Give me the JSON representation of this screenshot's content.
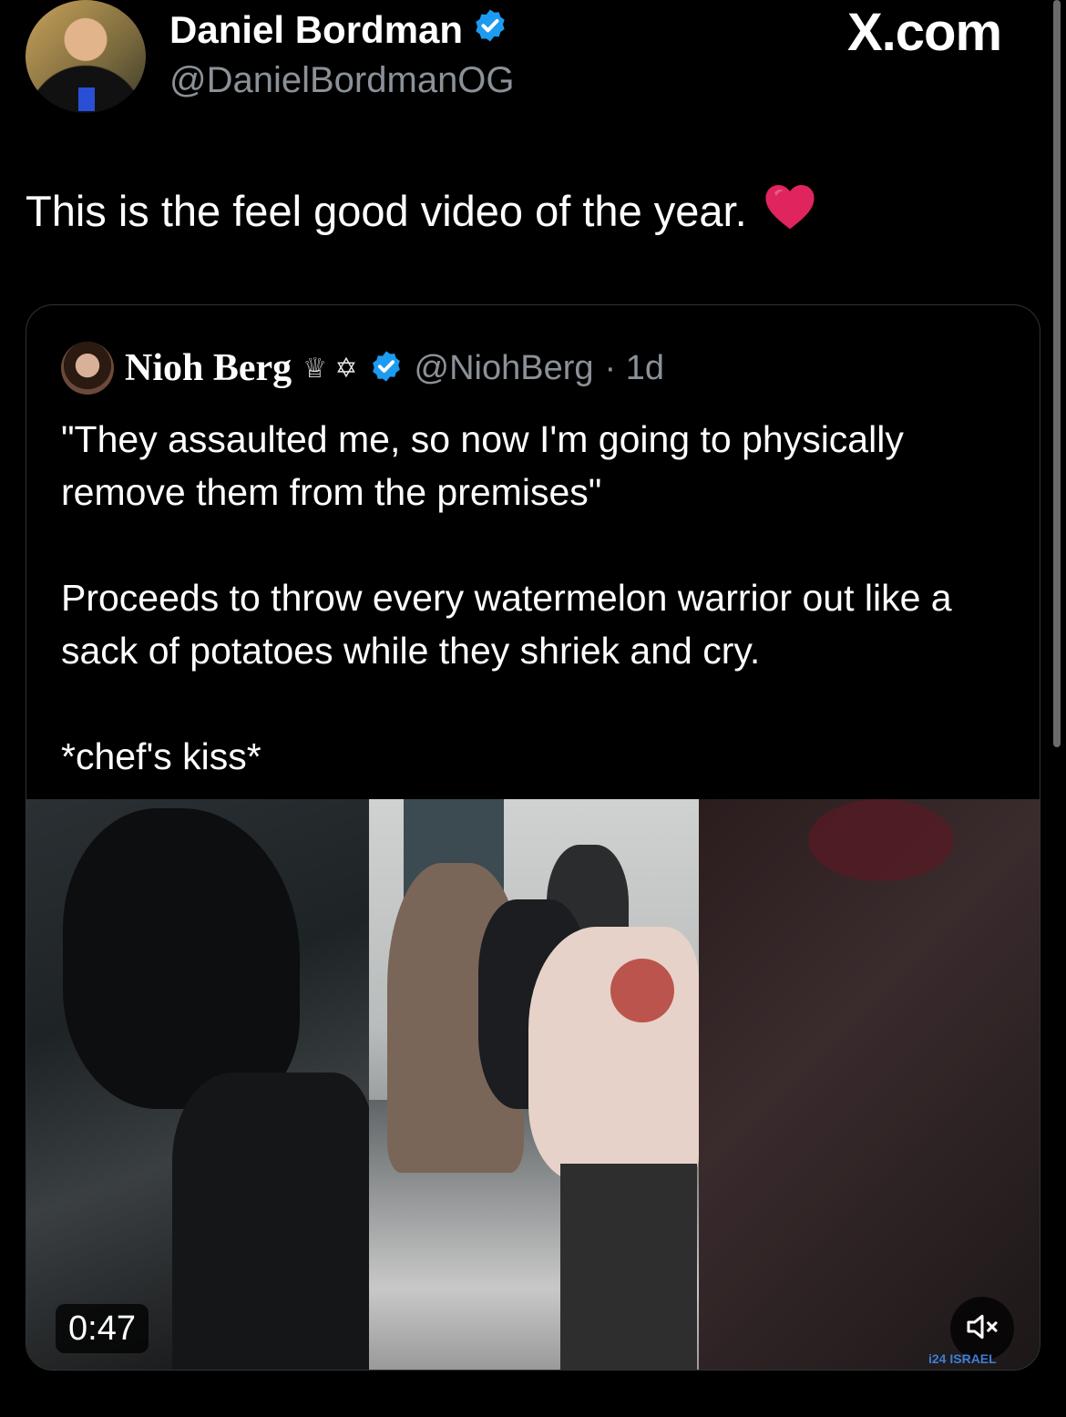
{
  "author": {
    "name": "Daniel Bordman",
    "handle": "@DanielBordmanOG",
    "avatar_icon": "avatar-photo",
    "verified_icon": "verified-badge-icon"
  },
  "brand": {
    "label": "X.com"
  },
  "tweet": {
    "text": "This is the feel good video of the year.",
    "emoji_icon": "red-heart-icon"
  },
  "quoted": {
    "name": "Nioh Berg",
    "symbols": "♕ ✡",
    "handle": "@NiohBerg",
    "time": "· 1d",
    "paragraphs": [
      "\"They assaulted me, so now I'm going to physically remove them from the premises\"",
      "Proceeds to throw every watermelon warrior out like a sack of potatoes while they shriek and cry.",
      "*chef's kiss*"
    ],
    "video": {
      "duration": "0:47",
      "mute_icon": "speaker-muted-icon",
      "watermark": "i24 ISRAEL"
    }
  },
  "colors": {
    "background": "#000000",
    "text": "#ffffff",
    "secondary_text": "#8b9198",
    "verified_blue": "#1d9bf0",
    "heart_red": "#e0245e",
    "border": "#2f3336"
  }
}
